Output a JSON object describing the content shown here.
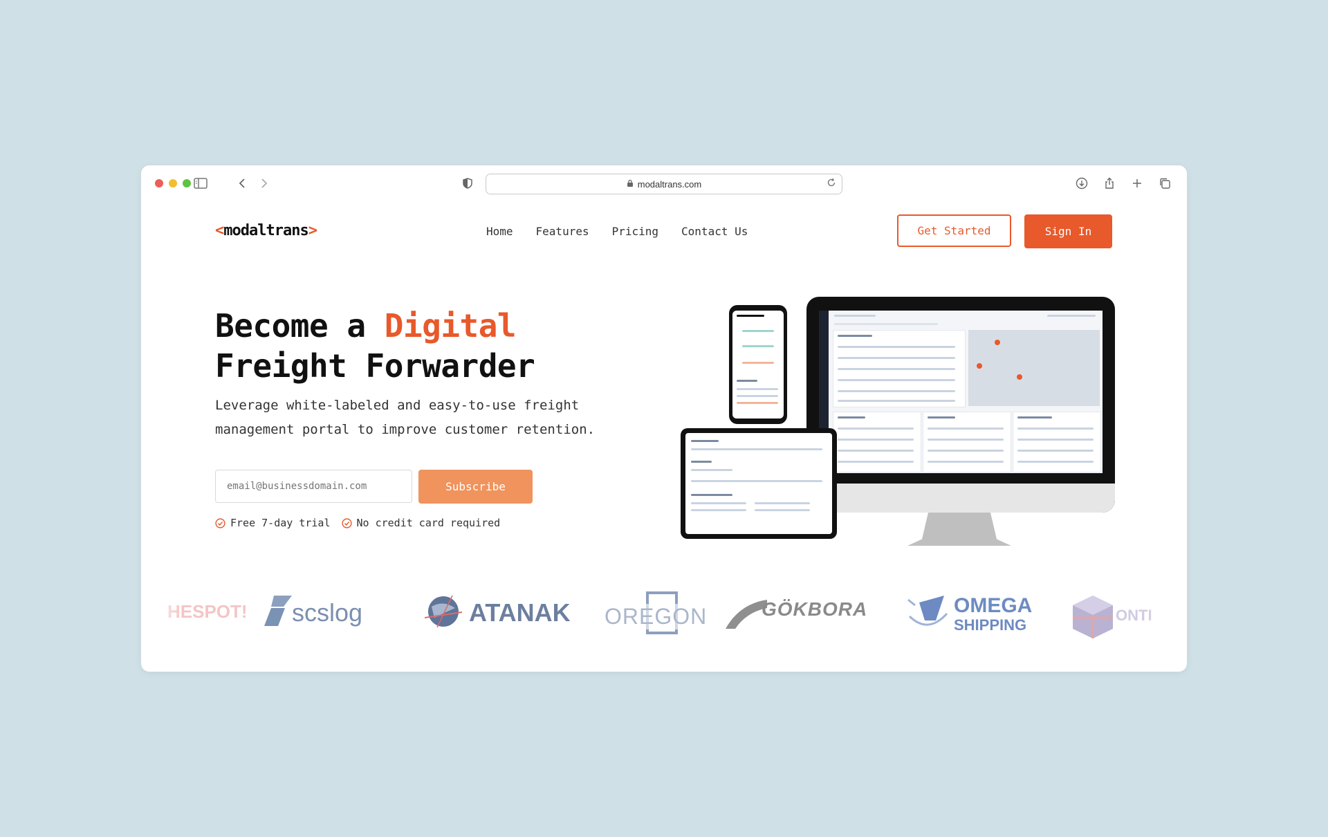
{
  "browser": {
    "url": "modaltrans.com"
  },
  "nav": {
    "logo_prefix": "<",
    "logo_text": "modaltrans",
    "logo_suffix": ">",
    "links": [
      "Home",
      "Features",
      "Pricing",
      "Contact Us"
    ],
    "get_started": "Get Started",
    "sign_in": "Sign In"
  },
  "hero": {
    "title_part1": "Become a ",
    "title_accent": "Digital",
    "title_part2": "Freight Forwarder",
    "subtitle": "Leverage white-labeled and easy-to-use freight management portal to improve customer retention.",
    "email_placeholder": "email@businessdomain.com",
    "subscribe": "Subscribe",
    "perks": [
      "Free 7-day trial",
      "No credit card required"
    ]
  },
  "logos": [
    "HESPOT!",
    "scslog",
    "ATANAK",
    "OREGON",
    "GÖKBORA",
    "OMEGA",
    "SHIPPING",
    "ONTI"
  ],
  "colors": {
    "accent": "#e8592b",
    "accent_light": "#f0935d",
    "background": "#cfe0e6"
  }
}
